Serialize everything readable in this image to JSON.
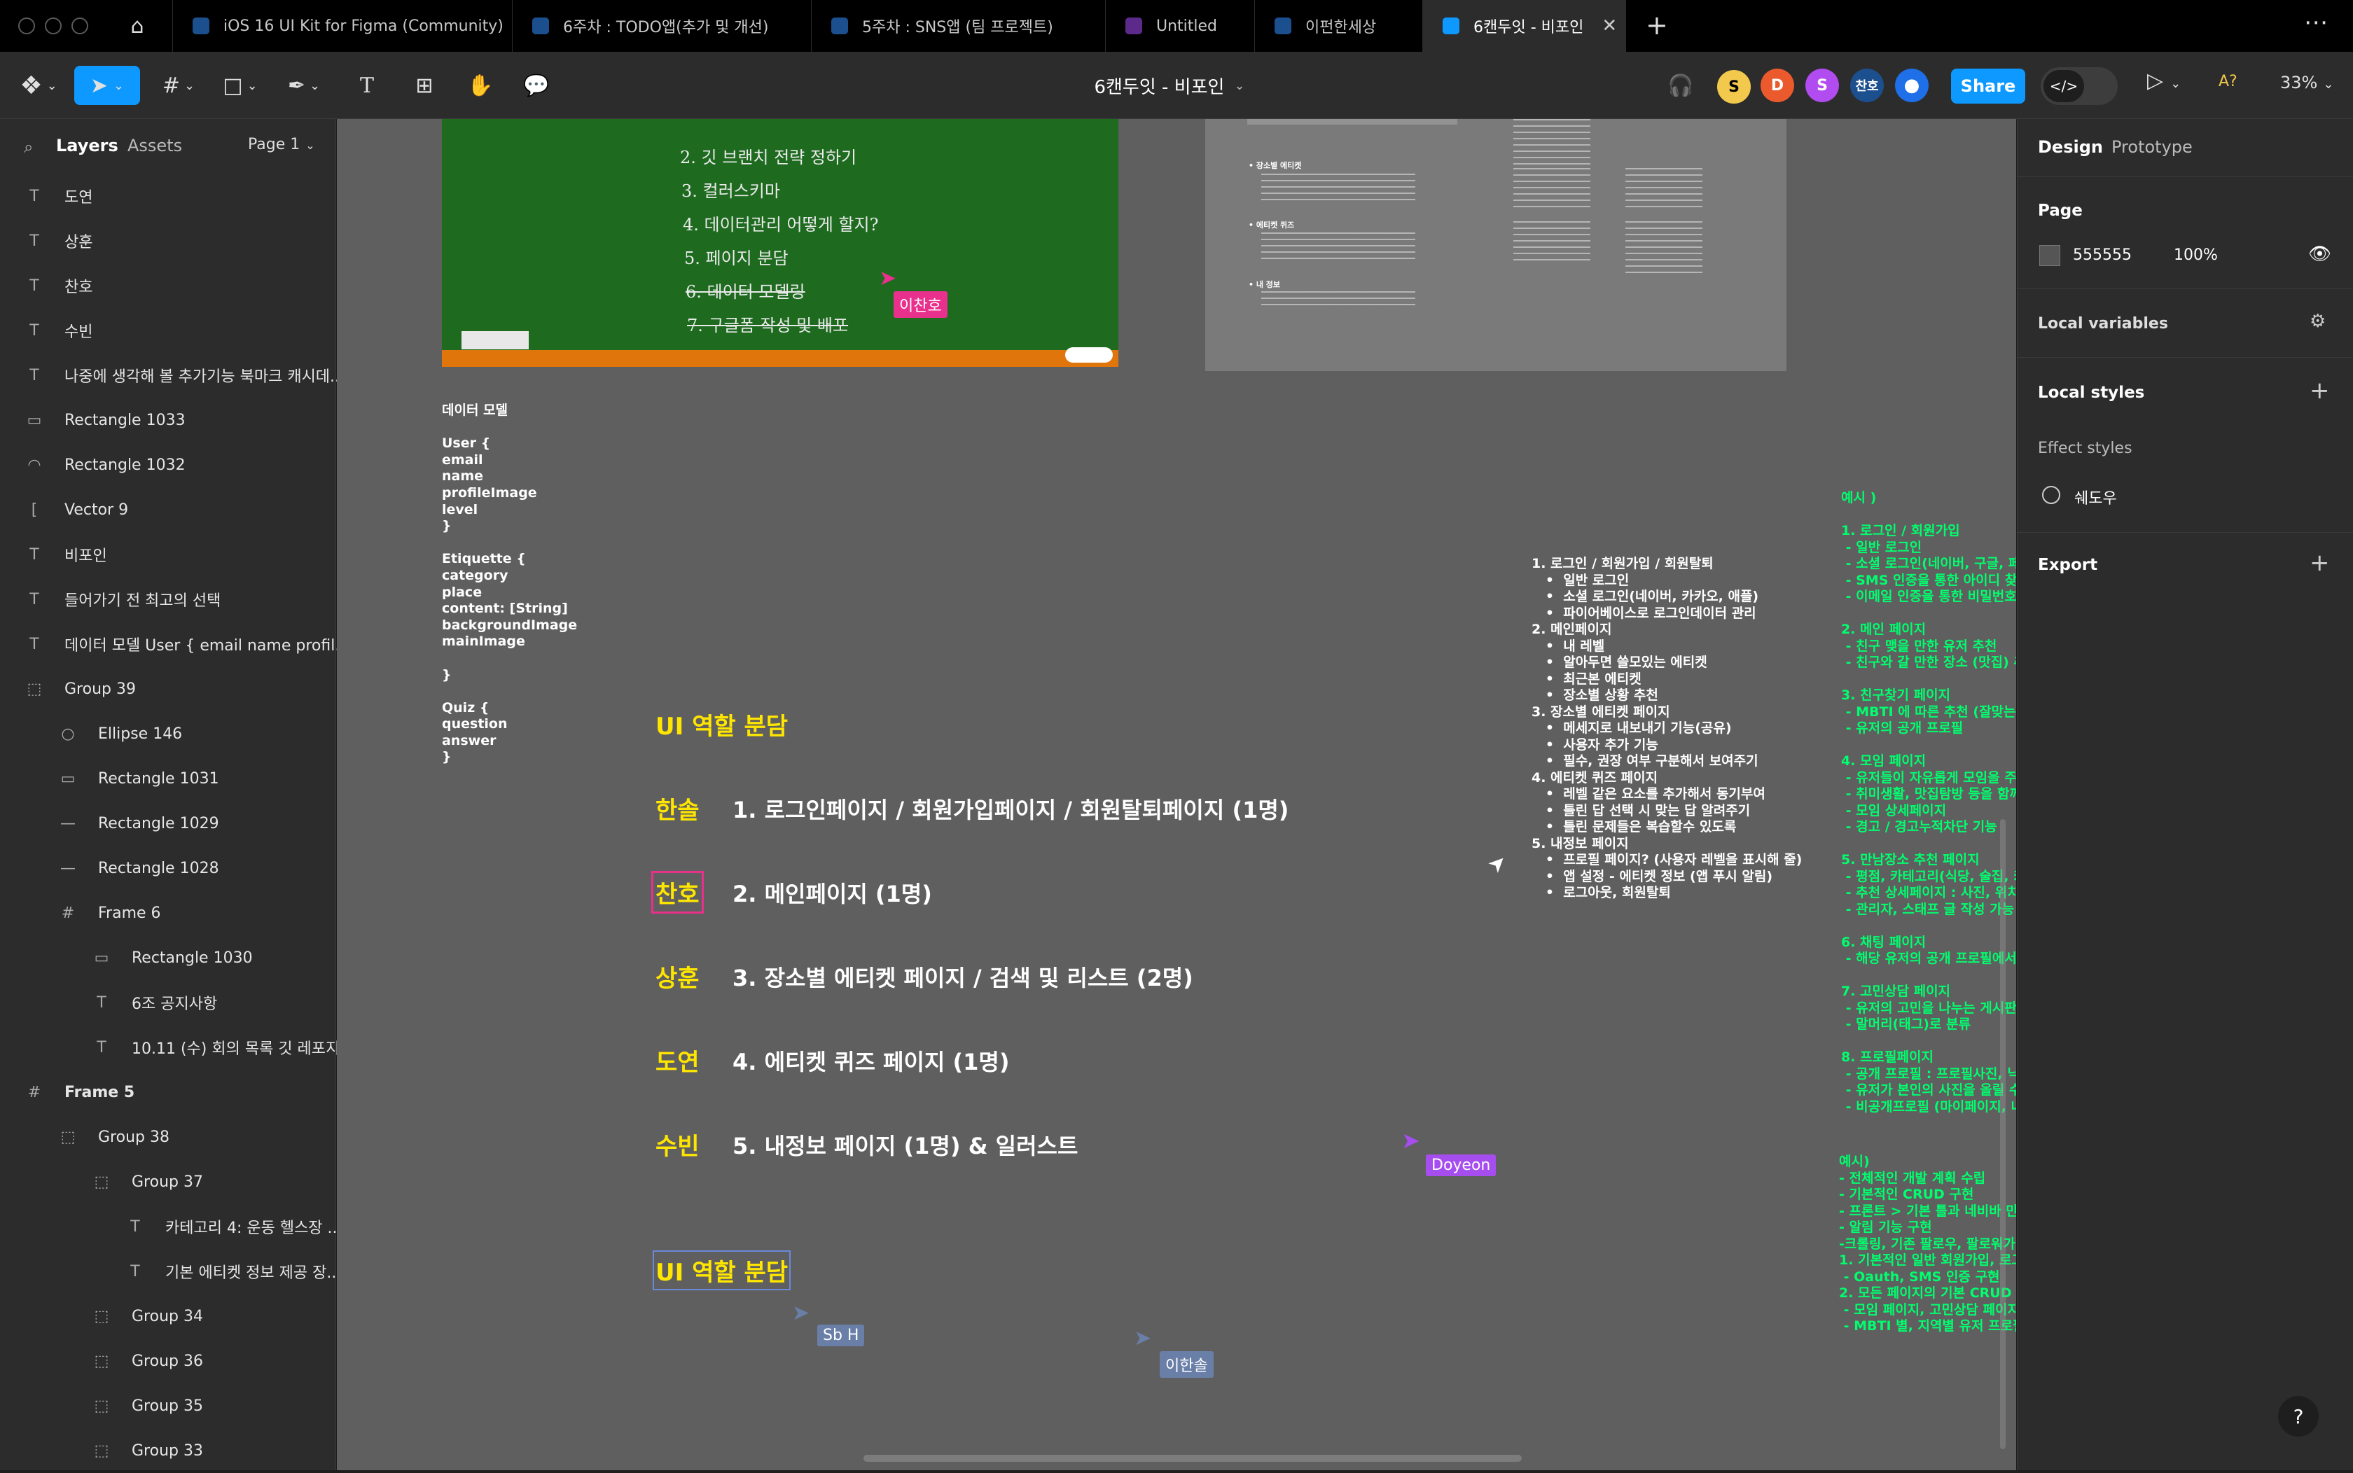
{
  "tabs": [
    {
      "label": "iOS 16 UI Kit for Figma (Community)",
      "active": false
    },
    {
      "label": "6주차 : TODO앱(추가 및 개선)",
      "active": false
    },
    {
      "label": "5주차 : SNS앱 (팀 프로젝트)",
      "active": false
    },
    {
      "label": "Untitled",
      "active": false
    },
    {
      "label": "이펀한세상",
      "active": false
    },
    {
      "label": "6캔두잇 - 비포인",
      "active": true
    }
  ],
  "toolbar": {
    "file_title": "6캔두잇 - 비포인",
    "share_label": "Share",
    "zoom": "33%",
    "users": [
      {
        "initial": "S",
        "color": "#f2c94c"
      },
      {
        "initial": "D",
        "color": "#eb5a2d"
      },
      {
        "initial": "S",
        "color": "#b14cf0"
      },
      {
        "initial": "찬호",
        "color": "#1c4f8e"
      },
      {
        "initial": "",
        "color": "#1e6fe8"
      }
    ]
  },
  "left_panel": {
    "tab_layers": "Layers",
    "tab_assets": "Assets",
    "page_selector": "Page 1",
    "layers": [
      {
        "icon": "T",
        "name": "도연",
        "indent": 0
      },
      {
        "icon": "T",
        "name": "상훈",
        "indent": 0
      },
      {
        "icon": "T",
        "name": "찬호",
        "indent": 0
      },
      {
        "icon": "T",
        "name": "수빈",
        "indent": 0
      },
      {
        "icon": "T",
        "name": "나중에 생각해 볼 추가기능 북마크 캐시데...",
        "indent": 0
      },
      {
        "icon": "▭",
        "name": "Rectangle 1033",
        "indent": 0
      },
      {
        "icon": "◠",
        "name": "Rectangle 1032",
        "indent": 0
      },
      {
        "icon": "[",
        "name": "Vector 9",
        "indent": 0
      },
      {
        "icon": "T",
        "name": "비포인",
        "indent": 0
      },
      {
        "icon": "T",
        "name": "들어가기 전 최고의 선택",
        "indent": 0
      },
      {
        "icon": "T",
        "name": "데이터 모델 User { email name profil...",
        "indent": 0
      },
      {
        "icon": "⬚",
        "name": "Group 39",
        "indent": 0
      },
      {
        "icon": "○",
        "name": "Ellipse 146",
        "indent": 1
      },
      {
        "icon": "▭",
        "name": "Rectangle 1031",
        "indent": 1
      },
      {
        "icon": "—",
        "name": "Rectangle 1029",
        "indent": 1
      },
      {
        "icon": "—",
        "name": "Rectangle 1028",
        "indent": 1
      },
      {
        "icon": "#",
        "name": "Frame 6",
        "indent": 1
      },
      {
        "icon": "▭",
        "name": "Rectangle 1030",
        "indent": 2
      },
      {
        "icon": "T",
        "name": "6조 공지사항",
        "indent": 2
      },
      {
        "icon": "T",
        "name": "10.11 (수) 회의 목록 깃 레포지...",
        "indent": 2
      },
      {
        "icon": "#",
        "name": "Frame 5",
        "indent": 0,
        "bold": true
      },
      {
        "icon": "⬚",
        "name": "Group 38",
        "indent": 1
      },
      {
        "icon": "⬚",
        "name": "Group 37",
        "indent": 2
      },
      {
        "icon": "T",
        "name": "카테고리 4: 운동 헬스장 ...",
        "indent": 3
      },
      {
        "icon": "T",
        "name": "기본 에티켓 정보 제공 장...",
        "indent": 3
      },
      {
        "icon": "⬚",
        "name": "Group 34",
        "indent": 2
      },
      {
        "icon": "⬚",
        "name": "Group 36",
        "indent": 2
      },
      {
        "icon": "⬚",
        "name": "Group 35",
        "indent": 2
      },
      {
        "icon": "⬚",
        "name": "Group 33",
        "indent": 2
      }
    ]
  },
  "right_panel": {
    "tab_design": "Design",
    "tab_prototype": "Prototype",
    "page_heading": "Page",
    "page_color": "555555",
    "page_opacity": "100%",
    "local_variables": "Local variables",
    "local_styles": "Local styles",
    "effect_styles": "Effect styles",
    "effect_style_name": "쉐도우",
    "export": "Export"
  },
  "canvas": {
    "board_lines": [
      "2. 깃 브랜치 전략 정하기",
      "3. 컬러스키마",
      "4. 데이터관리 어떻게 할지?",
      "5. 페이지 분담",
      "6. 데이터 모델링",
      "7. 구글폼 작성 및 배포"
    ],
    "data_model": "데이터 모델\n\nUser {\nemail\nname\nprofileImage\nlevel\n}\n\nEtiquette {\ncategory\nplace\ncontent: [String]\nbackgroundImage\nmainImage\n\n}\n\nQuiz {\nquestion\nanswer\n}",
    "ui_heading": "UI 역할 분담",
    "roles": [
      {
        "name": "한솔",
        "task": "1. 로그인페이지 / 회원가입페이지 / 회원탈퇴페이지 (1명)"
      },
      {
        "name": "찬호",
        "task": "2. 메인페이지 (1명)"
      },
      {
        "name": "상훈",
        "task": "3. 장소별 에티켓 페이지 / 검색 및 리스트 (2명)"
      },
      {
        "name": "도연",
        "task": "4. 에티켓 퀴즈 페이지 (1명)"
      },
      {
        "name": "수빈",
        "task": "5. 내정보 페이지 (1명) & 일러스트"
      }
    ],
    "ui_heading_2": "UI 역할 분담",
    "feature_list": "1. 로그인 / 회원가입 / 회원탈퇴\n   •  일반 로그인\n   •  소셜 로그인(네이버, 카카오, 애플)\n   •  파이어베이스로 로그인데이터 관리\n2. 메인페이지\n   •  내 레벨\n   •  알아두면 쓸모있는 에티켓\n   •  최근본 에티켓\n   •  장소별 상황 추천\n3. 장소별 에티켓 페이지\n   •  메세지로 내보내기 기능(공유)\n   •  사용자 추가 기능\n   •  필수, 권장 여부 구분해서 보여주기\n4. 에티켓 퀴즈 페이지\n   •  레벨 같은 요소를 추가해서 동기부여\n   •  틀린 답 선택 시 맞는 답 알려주기\n   •  틀린 문제들은 복습할수 있도록\n5. 내정보 페이지\n   •  프로필 페이지? (사용자 레벨을 표시해 줄)\n   •  앱 설정 - 에티켓 정보 (앱 푸시 알림)\n   •  로그아웃, 회원탈퇴",
    "green_text_1": "예시 )\n\n1. 로그인 / 회원가입\n - 일반 로그인\n - 소셜 로그인(네이버, 구글, 페\n - SMS 인증을 통한 아이디 찾\n - 이메일 인증을 통한 비밀번호\n\n2. 메인 페이지\n - 친구 맺을 만한 유저 추천\n - 친구와 갈 만한 장소 (맛집) 추\n\n3. 친구찾기 페이지\n - MBTI 에 따른 추천 (잘맞는 \n - 유저의 공개 프로필\n\n4. 모임 페이지\n - 유저들이 자유롭게 모임을 주\n - 취미생활, 맛집탐방 등을 함께\n - 모임 상세페이지\n - 경고 / 경고누적차단 기능\n\n5. 만남장소 추천 페이지\n - 평점, 카테고리(식당, 술집, 카\n - 추천 상세페이지 : 사진, 위치\n - 관리자, 스태프 글 작성 가능 \n\n6. 채팅 페이지\n - 해당 유저의 공개 프로필에서\n\n7. 고민상담 페이지\n - 유저의 고민을 나누는 게시판\n - 말머리(태그)로 분류\n\n8. 프로필페이지\n - 공개 프로필 : 프로필사진, 닉\n - 유저가 본인의 사진을 올릴 수\n - 비공개프로필 (마이페이지, 내",
    "green_text_2": "예시)\n- 전체적인 개발 계획 수립\n- 기본적인 CRUD 구현\n- 프론트 > 기본 틀과 네비바 만\n- 알림 기능 구현\n-크롤링, 기존 팔로우, 팔로워가\n1. 기본적인 일반 회원가입, 로그\n - Oauth, SMS 인증 구현\n2. 모든 페이지의 기본 CRUD 구\n - 모임 페이지, 고민상담 페이지\n - MBTI 별, 지역별 유저 프로필",
    "cursors": [
      {
        "name": "이찬호",
        "color": "#e8308c"
      },
      {
        "name": "Doyeon",
        "color": "#a64df0"
      },
      {
        "name": "Sb H",
        "color": "#6a7fa8"
      },
      {
        "name": "이한솔",
        "color": "#6a7fa8"
      }
    ]
  },
  "colors": {
    "accent": "#0d99ff",
    "yellow": "#ffe600",
    "green": "#00ff6e",
    "board": "#1e6b20"
  }
}
